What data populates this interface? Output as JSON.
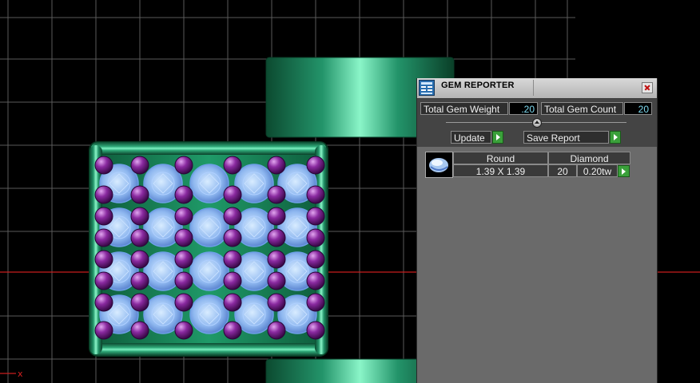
{
  "viewport": {
    "axis_label": "x"
  },
  "gem_reporter": {
    "title": "GEM REPORTER",
    "total_weight_label": "Total Gem Weight",
    "total_weight_value": ".20",
    "total_count_label": "Total Gem Count",
    "total_count_value": "20",
    "update_label": "Update",
    "save_report_label": "Save Report",
    "gems": [
      {
        "shape": "Round",
        "material": "Diamond",
        "size": "1.39 X 1.39",
        "count": "20",
        "weight": "0.20tw"
      }
    ]
  },
  "colors": {
    "grid": "#5a5a5a",
    "red_axis": "#c81e1e",
    "band_green": "#1e8a5c",
    "gem_blue": "#8fb8f0",
    "prong_purple": "#7a1a8a",
    "value_cyan": "#7fdcf2"
  }
}
